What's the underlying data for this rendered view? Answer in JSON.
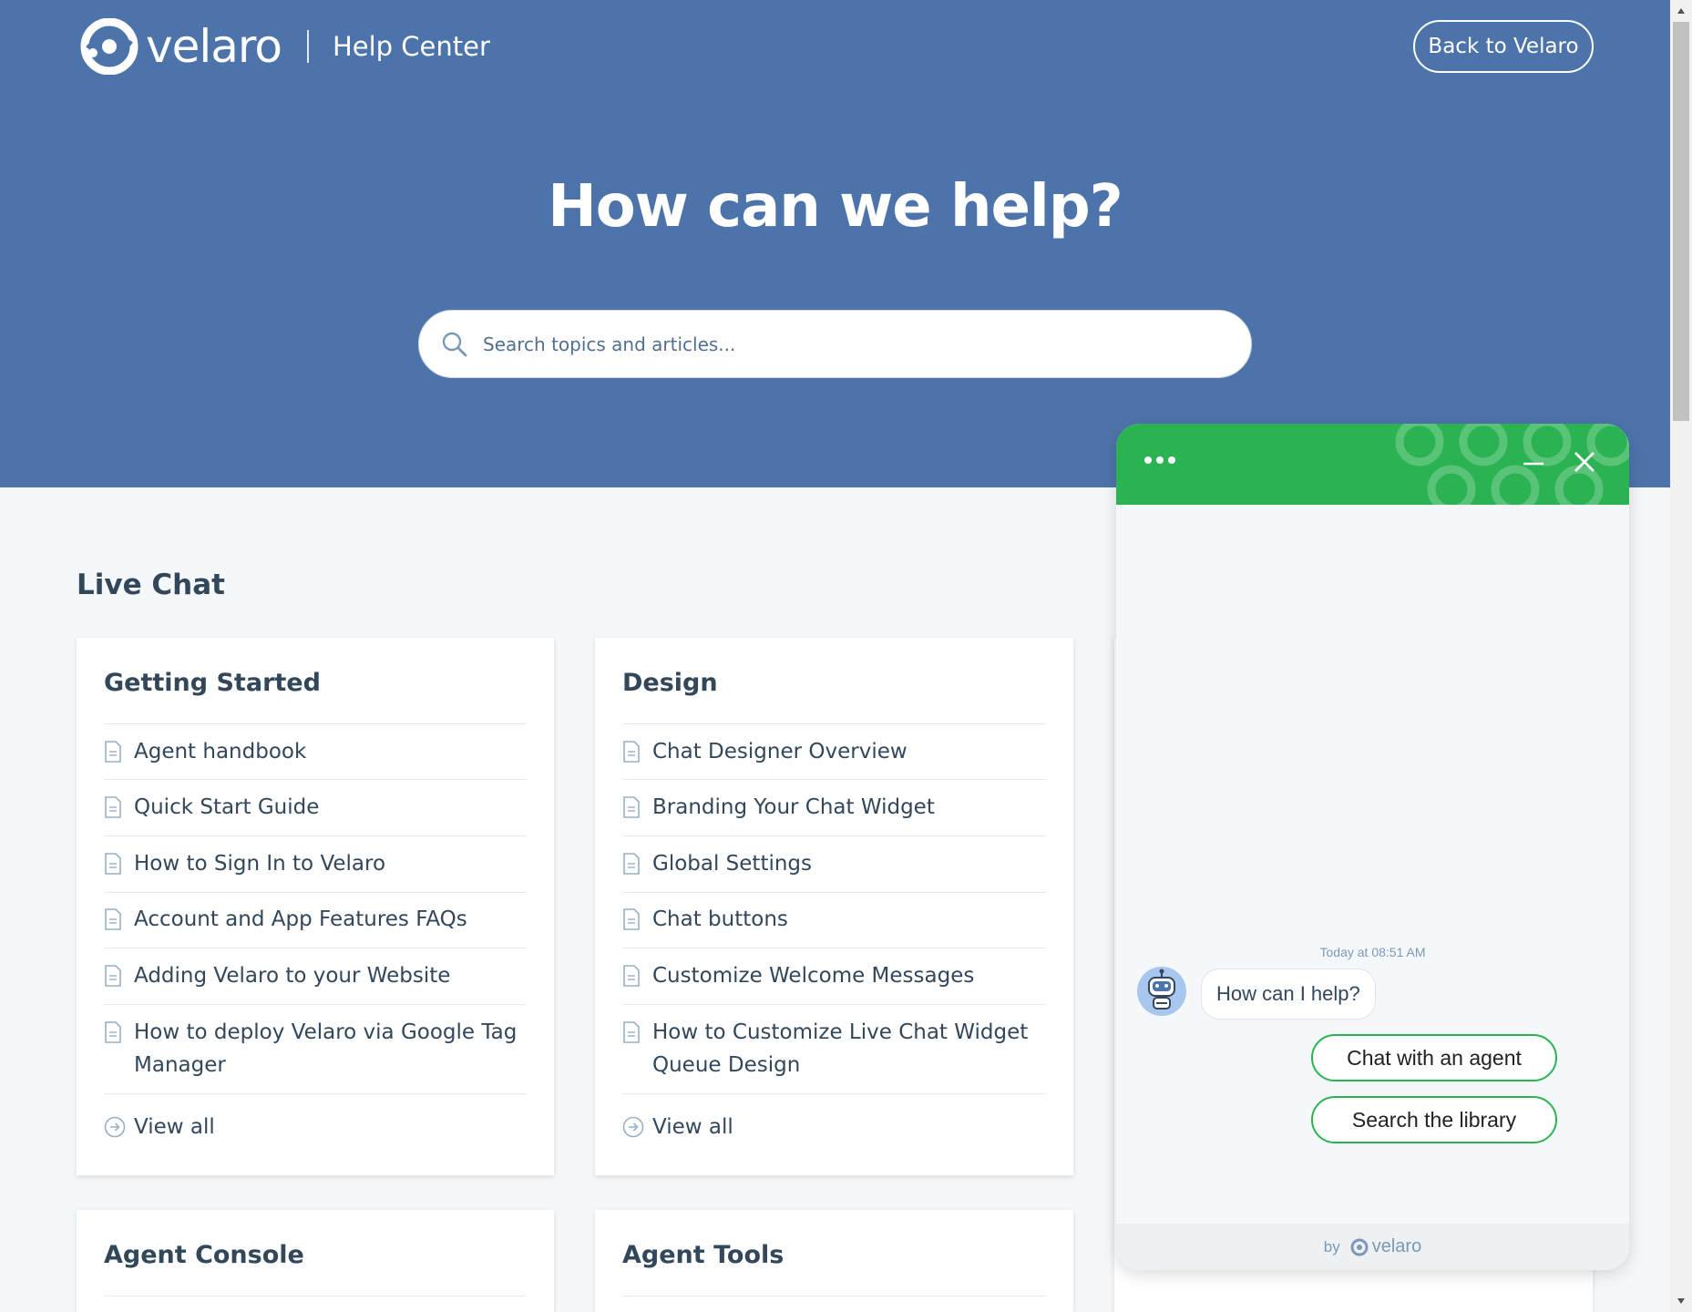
{
  "header": {
    "logo_word": "velaro",
    "subtitle": "Help Center",
    "back_label": "Back to Velaro"
  },
  "hero": {
    "title": "How can we help?",
    "search_placeholder": "Search topics and articles..."
  },
  "section": {
    "title": "Live Chat"
  },
  "cards": {
    "getting_started": {
      "title": "Getting Started",
      "articles": [
        "Agent handbook",
        "Quick Start Guide",
        "How to Sign In to Velaro",
        "Account and App Features FAQs",
        "Adding Velaro to your Website",
        "How to deploy Velaro via Google Tag Manager"
      ],
      "view_all": "View all"
    },
    "design": {
      "title": "Design",
      "articles": [
        "Chat Designer Overview",
        "Branding Your Chat Widget",
        "Global Settings",
        "Chat buttons",
        "Customize Welcome Messages",
        "How to Customize Live Chat Widget Queue Design"
      ],
      "view_all": "View all"
    },
    "agent_console": {
      "title": "Agent Console"
    },
    "agent_tools": {
      "title": "Agent Tools"
    }
  },
  "chat": {
    "timestamp": "Today at 08:51 AM",
    "bot_message": "How can I help?",
    "options": [
      "Chat with an agent",
      "Search the library"
    ],
    "footer_by": "by",
    "footer_brand": "velaro"
  },
  "colors": {
    "hero_bg": "#4d74aa",
    "chat_accent": "#2bb353",
    "text": "#33475b"
  },
  "icons": {
    "search": "search-icon",
    "article": "document-icon",
    "view_all": "arrow-circle-icon",
    "chat_menu": "more-horizontal-icon",
    "chat_minimize": "minimize-icon",
    "chat_close": "close-icon",
    "bot": "robot-avatar-icon"
  }
}
